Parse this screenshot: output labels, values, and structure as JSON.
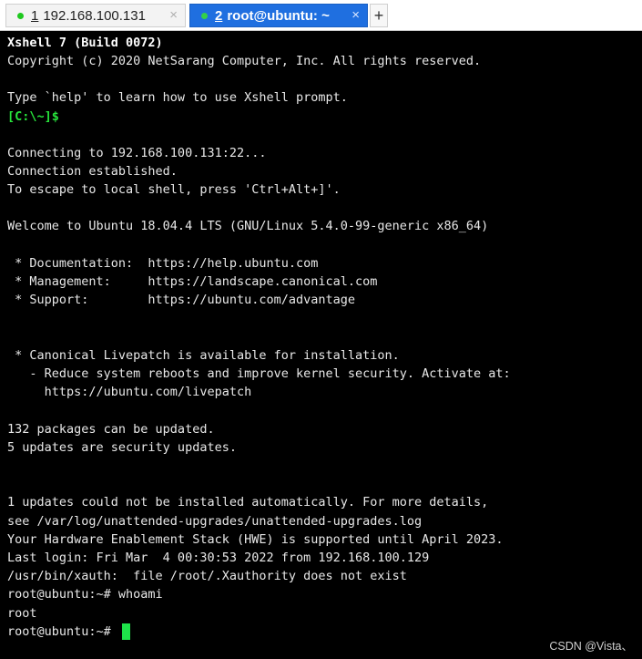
{
  "tabs": [
    {
      "number": "1",
      "title": "192.168.100.131",
      "close": "×",
      "status_color": "#1ec81e"
    },
    {
      "number": "2",
      "title": "root@ubuntu: ~",
      "close": "×",
      "status_color": "#34d04a"
    }
  ],
  "new_tab_label": "+",
  "terminal": {
    "lines": [
      "Xshell 7 (Build 0072)",
      "Copyright (c) 2020 NetSarang Computer, Inc. All rights reserved.",
      "",
      "Type `help' to learn how to use Xshell prompt.",
      "[C:\\~]$",
      "",
      "Connecting to 192.168.100.131:22...",
      "Connection established.",
      "To escape to local shell, press 'Ctrl+Alt+]'.",
      "",
      "Welcome to Ubuntu 18.04.4 LTS (GNU/Linux 5.4.0-99-generic x86_64)",
      "",
      " * Documentation:  https://help.ubuntu.com",
      " * Management:     https://landscape.canonical.com",
      " * Support:        https://ubuntu.com/advantage",
      "",
      "",
      " * Canonical Livepatch is available for installation.",
      "   - Reduce system reboots and improve kernel security. Activate at:",
      "     https://ubuntu.com/livepatch",
      "",
      "132 packages can be updated.",
      "5 updates are security updates.",
      "",
      "",
      "1 updates could not be installed automatically. For more details,",
      "see /var/log/unattended-upgrades/unattended-upgrades.log",
      "Your Hardware Enablement Stack (HWE) is supported until April 2023.",
      "Last login: Fri Mar  4 00:30:53 2022 from 192.168.100.129",
      "/usr/bin/xauth:  file /root/.Xauthority does not exist",
      "root@ubuntu:~# whoami",
      "root",
      "root@ubuntu:~# "
    ]
  },
  "watermark": "CSDN @Vista、",
  "colors": {
    "active_tab": "#1f6fe0",
    "prompt_green": "#27e33b",
    "cursor": "#1ee34a"
  }
}
